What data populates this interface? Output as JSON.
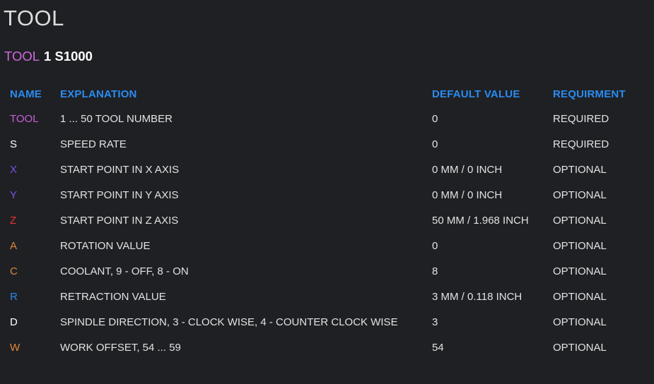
{
  "page": {
    "title": "TOOL"
  },
  "syntax": {
    "keyword": "TOOL",
    "arguments": "1 S1000"
  },
  "table": {
    "headers": {
      "name": "NAME",
      "explanation": "EXPLANATION",
      "default_value": "DEFAULT VALUE",
      "requirement": "REQUIRMENT"
    },
    "rows": [
      {
        "name": "TOOL",
        "name_color": "#c45fd6",
        "explanation": "1 ... 50 TOOL NUMBER",
        "default_value": "0",
        "requirement": "REQUIRED"
      },
      {
        "name": "S",
        "name_color": "#ffffff",
        "explanation": "SPEED RATE",
        "default_value": "0",
        "requirement": "REQUIRED"
      },
      {
        "name": "X",
        "name_color": "#7a52e8",
        "explanation": "START POINT IN X AXIS",
        "default_value": "0 MM / 0 INCH",
        "requirement": "OPTIONAL"
      },
      {
        "name": "Y",
        "name_color": "#7a52e8",
        "explanation": "START POINT IN Y AXIS",
        "default_value": "0 MM / 0 INCH",
        "requirement": "OPTIONAL"
      },
      {
        "name": "Z",
        "name_color": "#e8352e",
        "explanation": "START POINT IN Z AXIS",
        "default_value": "50 MM / 1.968 INCH",
        "requirement": "OPTIONAL"
      },
      {
        "name": "A",
        "name_color": "#e0883a",
        "explanation": "ROTATION VALUE",
        "default_value": "0",
        "requirement": "OPTIONAL"
      },
      {
        "name": "C",
        "name_color": "#e0883a",
        "explanation": "COOLANT, 9 - OFF, 8 - ON",
        "default_value": "8",
        "requirement": "OPTIONAL"
      },
      {
        "name": "R",
        "name_color": "#2e86e8",
        "explanation": "RETRACTION VALUE",
        "default_value": "3 MM / 0.118 INCH",
        "requirement": "OPTIONAL"
      },
      {
        "name": "D",
        "name_color": "#ffffff",
        "explanation": "SPINDLE DIRECTION, 3 - CLOCK WISE, 4 - COUNTER CLOCK WISE",
        "default_value": "3",
        "requirement": "OPTIONAL"
      },
      {
        "name": "W",
        "name_color": "#e0883a",
        "explanation": "WORK OFFSET, 54 ... 59",
        "default_value": "54",
        "requirement": "OPTIONAL"
      }
    ]
  }
}
